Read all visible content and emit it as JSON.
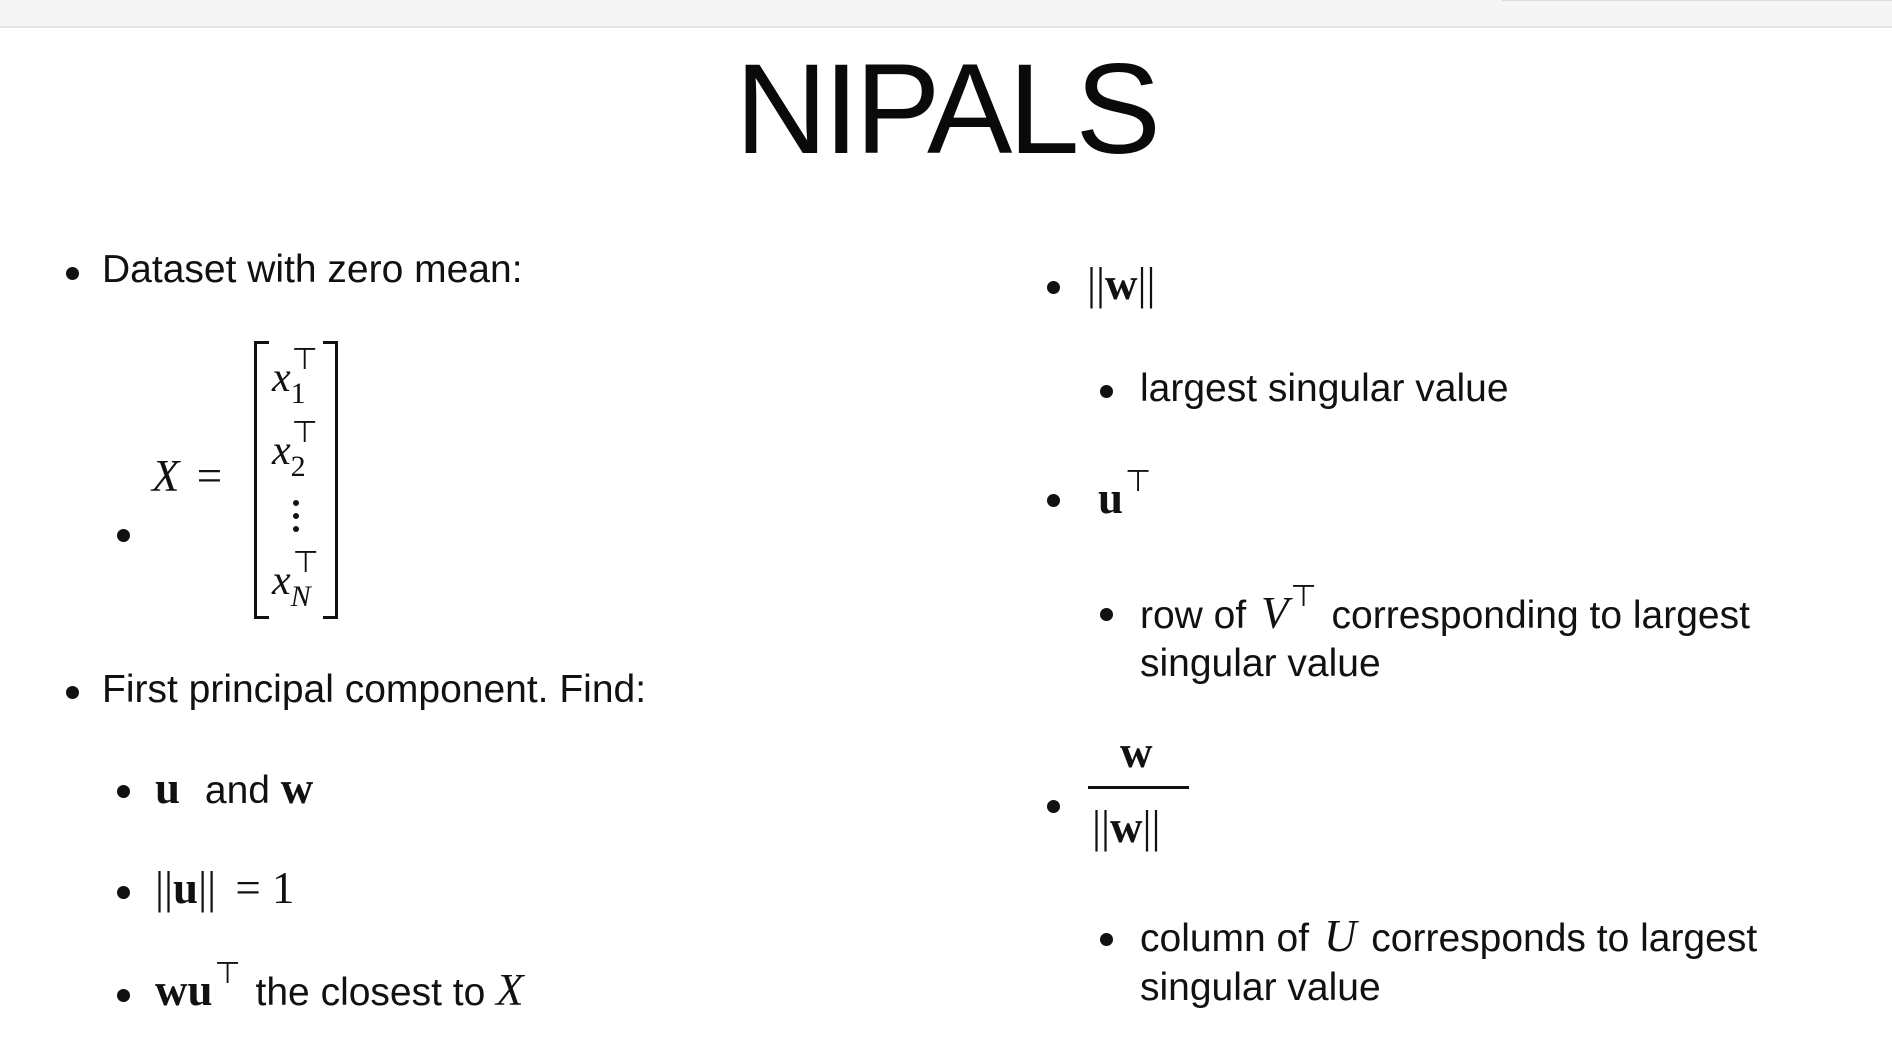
{
  "title": "NIPALS",
  "left": {
    "dataset_label": "Dataset with zero mean:",
    "matrix": {
      "lhs": "X",
      "equals": "=",
      "var": "x",
      "transpose": "⊤",
      "row_indices": [
        "1",
        "2",
        "N"
      ],
      "ellipsis": "⋮"
    },
    "first_pc_label": "First principal component. Find:",
    "item_u_and_w": {
      "u": "u",
      "and": "and",
      "w": "w"
    },
    "item_norm_u": {
      "norm_open": "||",
      "var": "u",
      "norm_close": "||",
      "rhs": "= 1"
    },
    "item_closest": {
      "w": "w",
      "u": "u",
      "transpose": "⊤",
      "text": "the closest to",
      "x": "X"
    }
  },
  "right": {
    "norm_w": {
      "norm_open": "||",
      "var": "w",
      "norm_close": "||"
    },
    "largest_singular_value": "largest singular value",
    "u_transpose": {
      "var": "u",
      "transpose": "⊤"
    },
    "row_of_vt": {
      "text_before": "row of",
      "var": "V",
      "transpose": "⊤",
      "text_after": "corresponding to largest",
      "line2": "singular value"
    },
    "fraction": {
      "numerator": "w",
      "denominator_open": "||",
      "denominator_var": "w",
      "denominator_close": "||"
    },
    "column_of_u": {
      "text_before": "column of",
      "var": "U",
      "text_after": "corresponds to largest",
      "line2": "singular value"
    }
  }
}
